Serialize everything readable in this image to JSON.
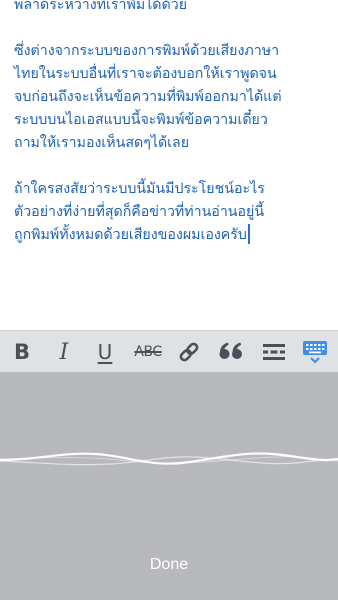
{
  "editor": {
    "lines": [
      "พลาดระหว่างที่เราพิมได้ด้วย",
      "",
      "ซึ่งต่างจากระบบของการพิมพ์ด้วยเสียงภาษา",
      "ไทยในระบบอื่นที่เราจะต้องบอกให้เราพูดจน",
      "จบก่อนถึงจะเห็นข้อความที่พิมพ์ออกมาได้แต่",
      "ระบบบนไอเอสแบบนี้จะพิมพ์ข้อความเดี๋ยว",
      "ถามให้เรามองเห็นสดๆได้เลย",
      "",
      "ถ้าใครสงสัยว่าระบบนี้มันมีประโยชน์อะไร",
      "ตัวอย่างที่ง่ายที่สุดก็คือข่าวที่ท่านอ่านอยู่นี้",
      "ถูกพิมพ์ทั้งหมดด้วยเสียงของผมเองครับ"
    ]
  },
  "toolbar": {
    "bold": "B",
    "italic": "I",
    "underline": "U",
    "strikethrough": "ABC",
    "icons": {
      "link": "link-icon",
      "quote": "quote-icon",
      "more": "more-divider-icon",
      "keyboard": "keyboard-hide-icon"
    },
    "icon_color": "#4b4f57",
    "accent_color": "#3d8fe8"
  },
  "dictation": {
    "done_label": "Done",
    "background": "#b7b9bd"
  },
  "colors": {
    "text": "#1f62b3"
  }
}
